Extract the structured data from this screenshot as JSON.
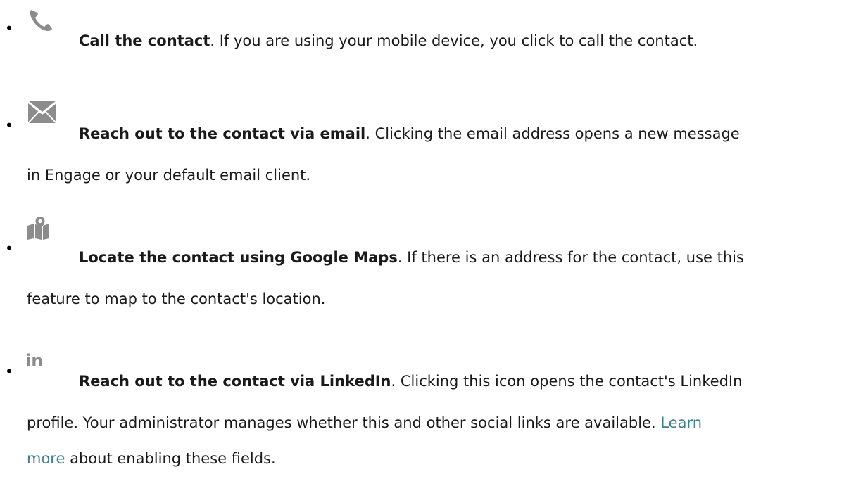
{
  "items": [
    {
      "icon": "phone-icon",
      "title": "Call the contact",
      "text": ". If you are using your mobile device, you click to call the contact."
    },
    {
      "icon": "envelope-icon",
      "title": "Reach out to the contact via email",
      "text": ". Clicking the email address opens a new message",
      "continuation": "in Engage or your default email client."
    },
    {
      "icon": "map-pin-icon",
      "title": "Locate the contact using Google Maps",
      "text": ". If there is an address for the contact, use this",
      "continuation": "feature to map to the contact's location."
    },
    {
      "icon": "linkedin-icon",
      "icon_text": "in",
      "title": "Reach out to the contact via LinkedIn",
      "text": ". Clicking this icon opens the contact's LinkedIn",
      "continuation": "profile. Your administrator manages whether this and other social links are available.",
      "link_part1": "Learn",
      "link_part2": "more",
      "after_link": " about enabling these fields."
    }
  ],
  "colors": {
    "icon_gray": "#8c8c8c",
    "link": "#3f7f8c"
  }
}
